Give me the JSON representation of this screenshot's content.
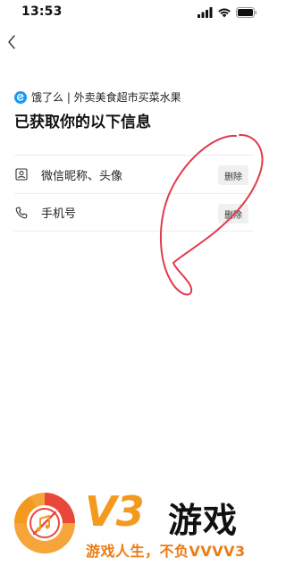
{
  "status_bar": {
    "time": "13:53"
  },
  "header": {
    "app_name": "饿了么 | 外卖美食超市买菜水果",
    "title": "已获取你的以下信息"
  },
  "info_items": [
    {
      "icon": "portrait-icon",
      "label": "微信昵称、头像",
      "action": "删除"
    },
    {
      "icon": "phone-icon",
      "label": "手机号",
      "action": "删除"
    }
  ],
  "watermark": {
    "brand": "V3",
    "title": "游戏",
    "slogan": "游戏人生，不负VVVV3"
  },
  "colors": {
    "app_logo": "#1a9bf0",
    "annotation": "#e23a4b",
    "watermark_orange": "#f39a1e",
    "watermark_red": "#e9473c"
  }
}
